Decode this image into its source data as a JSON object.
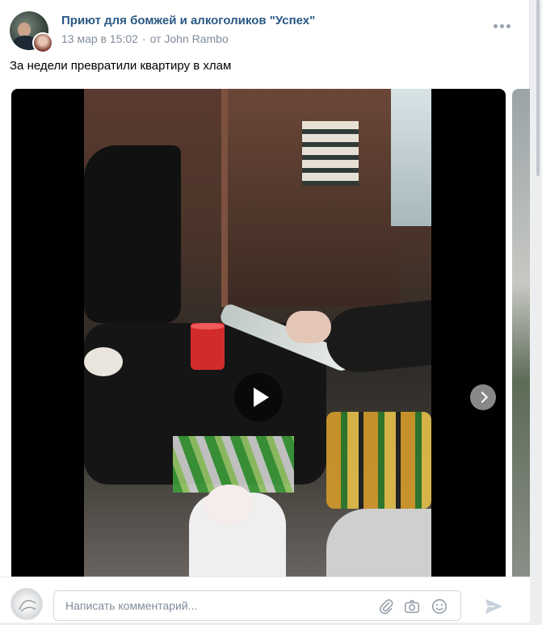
{
  "post": {
    "group_name": "Приют для бомжей и алкоголиков \"Успех\"",
    "date": "13 мар в 15:02",
    "separator": "·",
    "author": "от John Rambo",
    "text": "За недели превратили квартиру в хлам"
  },
  "comment": {
    "placeholder": "Написать комментарий..."
  },
  "icons": {
    "more": "more-dots-icon",
    "play": "play-icon",
    "next": "chevron-right-icon",
    "attach": "paperclip-icon",
    "camera": "camera-icon",
    "emoji": "smile-icon",
    "send": "send-icon"
  },
  "colors": {
    "link": "#2a5885",
    "meta": "#818c99",
    "icon": "#99a2ad"
  }
}
